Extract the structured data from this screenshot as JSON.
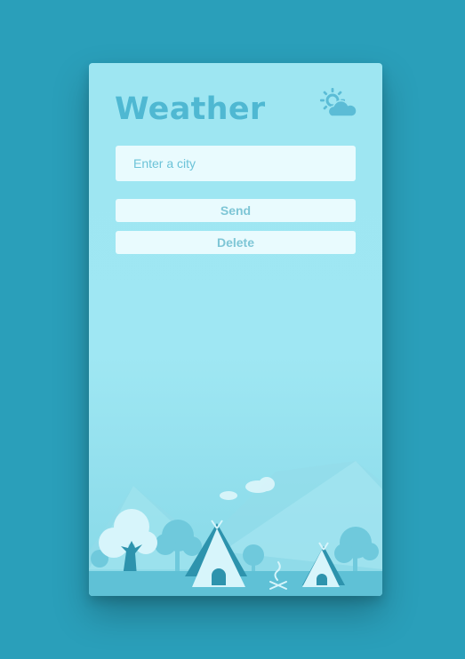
{
  "app": {
    "title": "Weather",
    "icon": "sun-cloud-icon"
  },
  "search": {
    "placeholder": "Enter a city",
    "value": ""
  },
  "actions": {
    "send_label": "Send",
    "delete_label": "Delete"
  },
  "theme": {
    "page_background": "#2a9fba",
    "card_background": "#9ee6f2",
    "accent": "#4fb8d2",
    "field_background": "#e9fbfe",
    "button_text": "#7ec6d6"
  }
}
